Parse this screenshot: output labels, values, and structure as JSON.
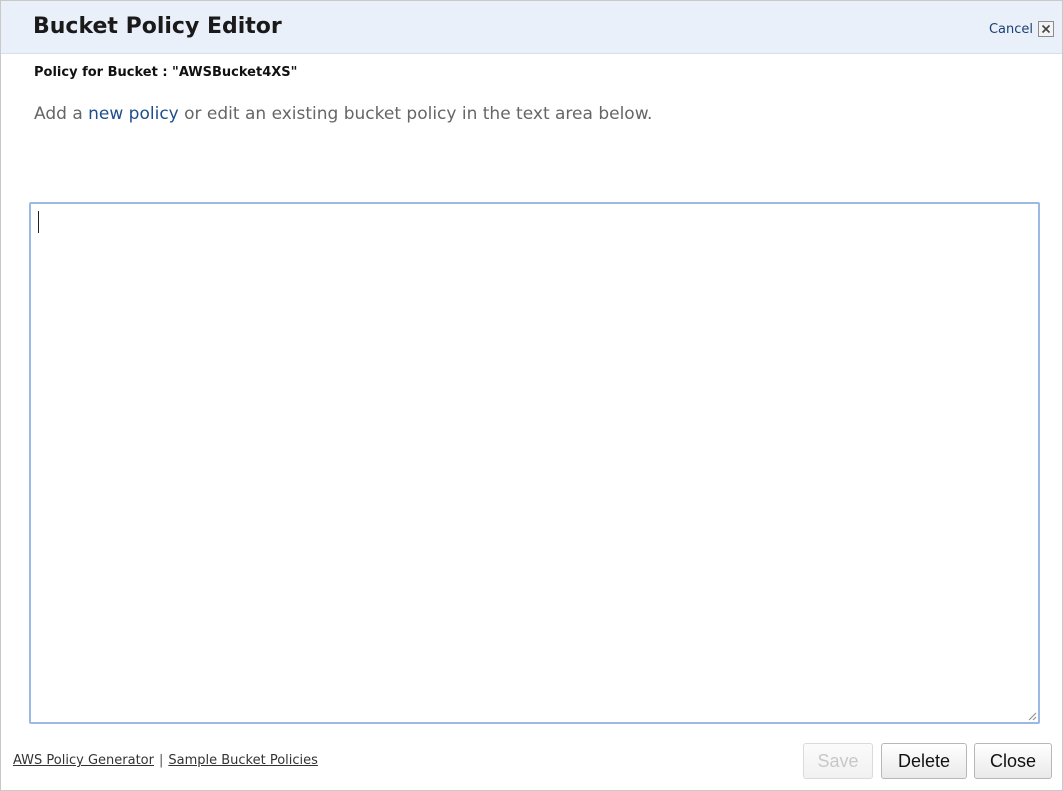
{
  "dialog": {
    "title": "Bucket Policy Editor",
    "cancel_label": "Cancel",
    "close_icon": "close-x-icon"
  },
  "bucket": {
    "label": "Policy for Bucket : \"AWSBucket4XS\""
  },
  "instruction": {
    "prefix": "Add a ",
    "link": "new policy",
    "suffix": " or edit an existing bucket policy in the text area below."
  },
  "editor": {
    "value": ""
  },
  "footer": {
    "links": [
      "AWS Policy Generator",
      "Sample Bucket Policies"
    ],
    "separator": "|"
  },
  "buttons": {
    "save": "Save",
    "delete": "Delete",
    "close": "Close"
  }
}
